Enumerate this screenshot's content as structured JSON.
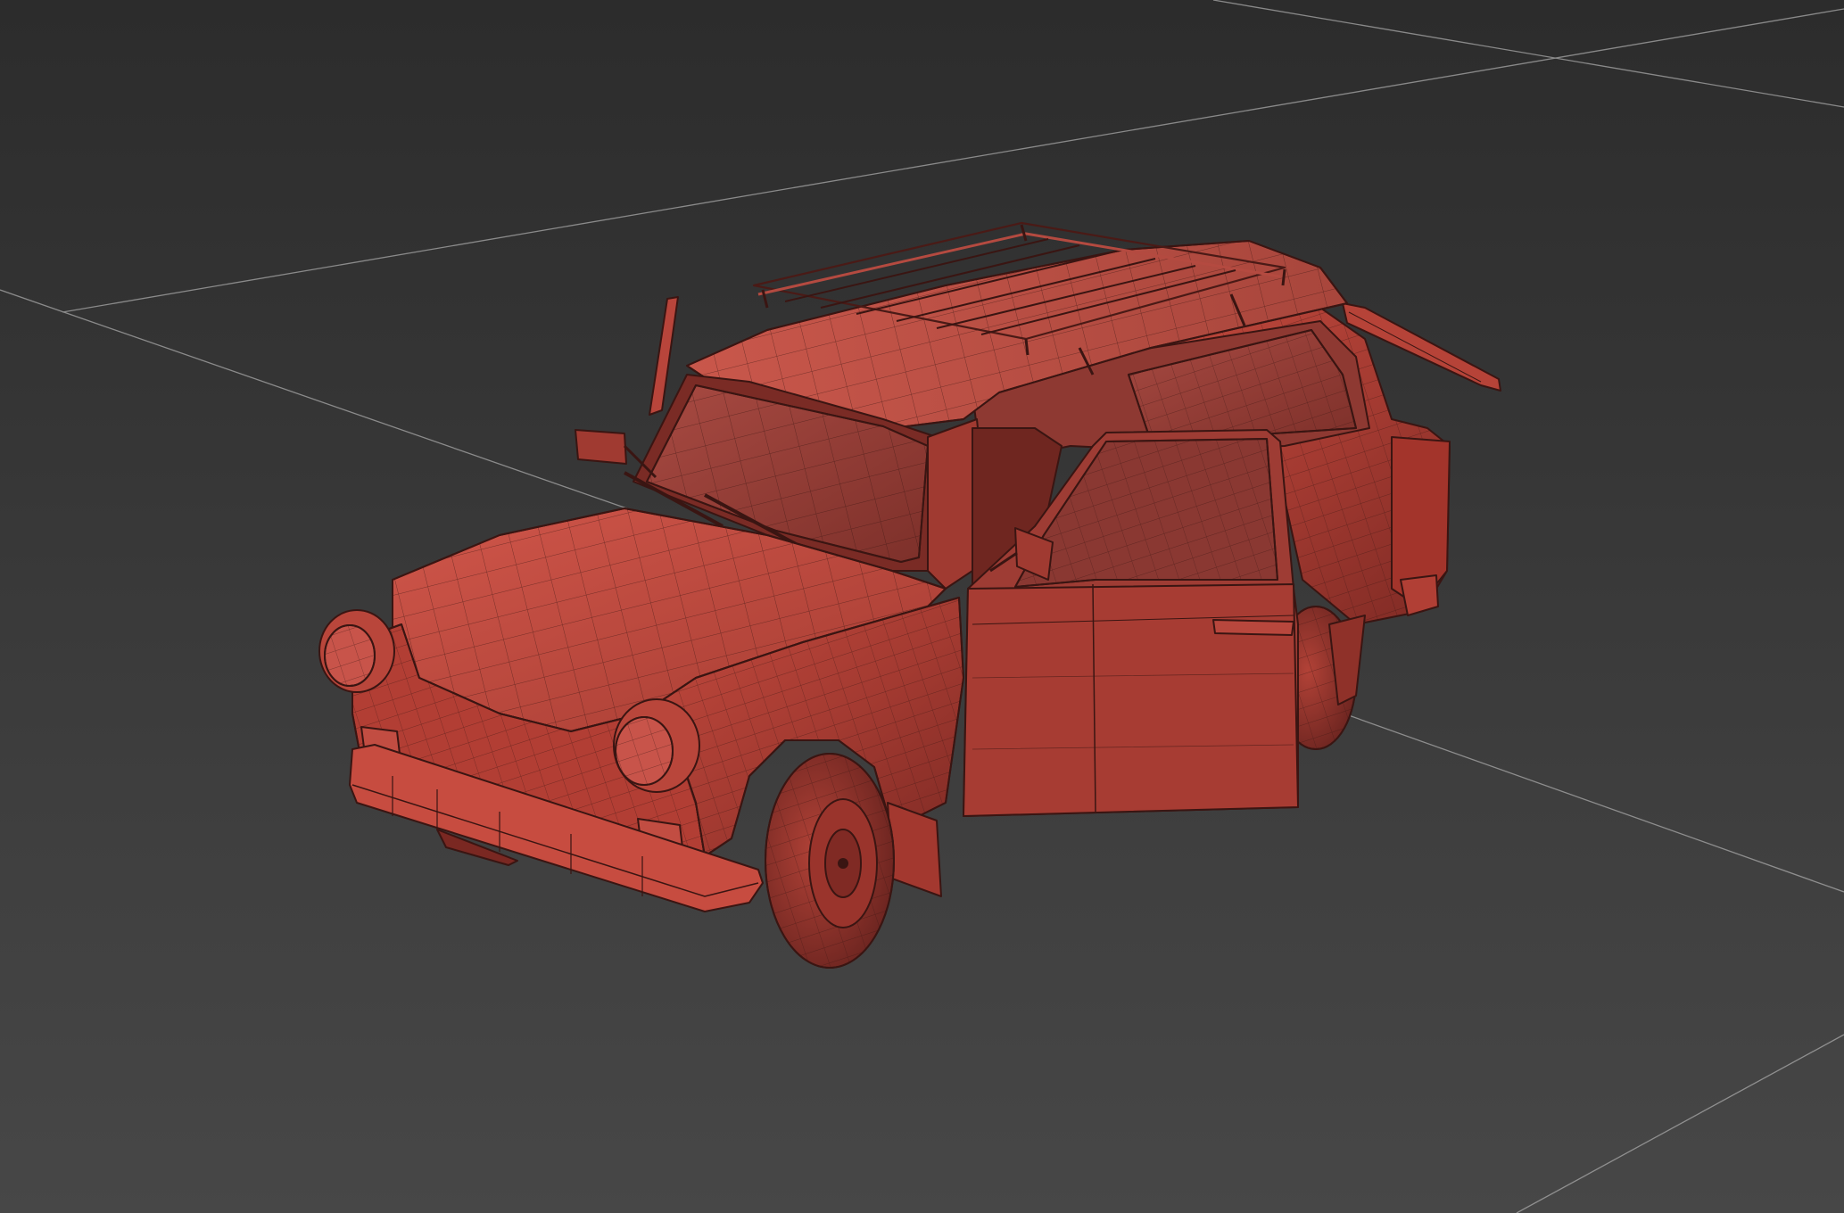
{
  "viewport": {
    "background_color": "#3a3a3a",
    "grid_color": "#a8a8a8",
    "model_color": "#c0473c",
    "wire_color": "#3a1512",
    "shading": "shaded-with-edged-faces"
  },
  "scene": {
    "objects": [
      {
        "name": "car-body"
      },
      {
        "name": "roof-rack"
      },
      {
        "name": "open-driver-door"
      },
      {
        "name": "open-tailgate"
      },
      {
        "name": "antenna"
      }
    ]
  }
}
